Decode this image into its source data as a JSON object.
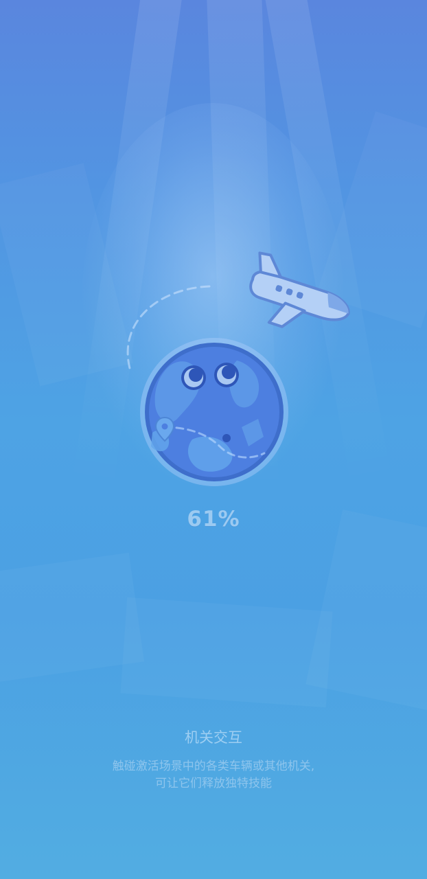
{
  "loading": {
    "progress_percent": 61,
    "progress_label": "61%"
  },
  "tip": {
    "title": "机关交互",
    "lines": [
      "触碰激活场景中的各类车辆或其他机关,",
      "可让它们释放独特技能"
    ]
  },
  "icons": {
    "mascot": "earth-mascot-icon",
    "plane": "airplane-icon",
    "pin": "location-pin-icon"
  },
  "colors": {
    "background_top": "#5a86de",
    "background_bottom": "#52ade2",
    "globe": "#4d7fe0"
  }
}
